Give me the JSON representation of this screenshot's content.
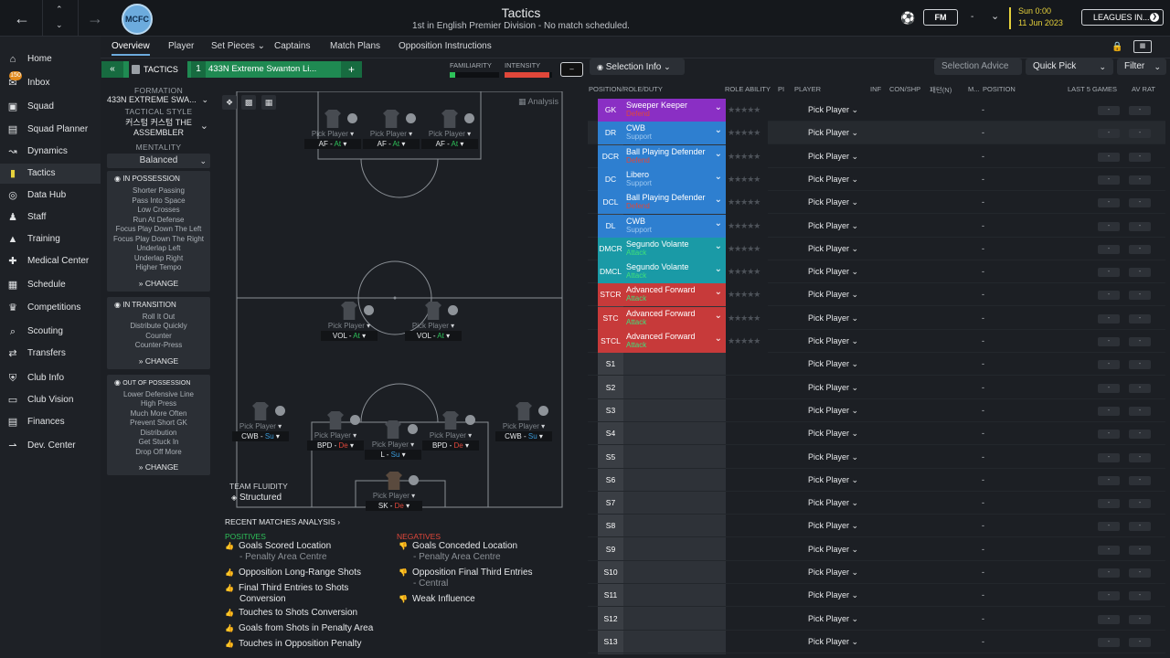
{
  "header": {
    "title": "Tactics",
    "subtitle": "1st in English Premier Division - No match scheduled.",
    "crest_text": "MCFC",
    "date_time": "Sun 0:00",
    "date": "11 Jun 2023",
    "fm_label": "FM",
    "leagues_label": "LEAGUES IN...",
    "dash": "-"
  },
  "sidebar": {
    "items": [
      {
        "label": "Home",
        "icon": "home-icon"
      },
      {
        "label": "Inbox",
        "icon": "inbox-icon",
        "badge": "150"
      },
      {
        "label": "Squad",
        "icon": "shirt-icon"
      },
      {
        "label": "Squad Planner",
        "icon": "planner-icon"
      },
      {
        "label": "Dynamics",
        "icon": "dynamics-icon"
      },
      {
        "label": "Tactics",
        "icon": "tactics-icon"
      },
      {
        "label": "Data Hub",
        "icon": "datahub-icon"
      },
      {
        "label": "Staff",
        "icon": "staff-icon"
      },
      {
        "label": "Training",
        "icon": "training-icon"
      },
      {
        "label": "Medical Center",
        "icon": "medical-icon"
      },
      {
        "label": "Schedule",
        "icon": "calendar-icon"
      },
      {
        "label": "Competitions",
        "icon": "trophy-icon"
      },
      {
        "label": "Scouting",
        "icon": "search-icon"
      },
      {
        "label": "Transfers",
        "icon": "transfer-icon"
      },
      {
        "label": "Club Info",
        "icon": "shield-icon"
      },
      {
        "label": "Club Vision",
        "icon": "vision-icon"
      },
      {
        "label": "Finances",
        "icon": "finances-icon"
      },
      {
        "label": "Dev. Center",
        "icon": "dev-icon"
      }
    ]
  },
  "tabs": [
    "Overview",
    "Player",
    "Set Pieces ⌄",
    "Captains",
    "Match Plans",
    "Opposition Instructions"
  ],
  "tactic_bar": {
    "tactics_label": "TACTICS",
    "slot": "1",
    "tactic_name": "433N Extreme Swanton Li...",
    "add": "+",
    "familiarity_label": "FAMILIARITY",
    "intensity_label": "INTENSITY",
    "selection_info": "Selection Info",
    "selection_advice": "Selection Advice",
    "quick_pick": "Quick Pick",
    "filter": "Filter",
    "familiarity_level": 0.12,
    "intensity_level": 0.95
  },
  "left_panel": {
    "formation_label": "FORMATION",
    "formation_value": "433N EXTREME SWA...",
    "style_label": "TACTICAL STYLE",
    "style_value_1": "커스텀 커스텀 THE",
    "style_value_2": "ASSEMBLER",
    "mentality_label": "MENTALITY",
    "mentality_value": "Balanced",
    "in_possession_title": "IN POSSESSION",
    "in_possession": [
      "Shorter Passing",
      "Pass Into Space",
      "Low Crosses",
      "Run At Defense",
      "Focus Play Down The Left",
      "Focus Play Down The Right",
      "Underlap Left",
      "Underlap Right",
      "Higher Tempo"
    ],
    "in_transition_title": "IN TRANSITION",
    "in_transition": [
      "Roll It Out",
      "Distribute Quickly",
      "Counter",
      "Counter-Press"
    ],
    "out_possession_title": "OUT OF POSSESSION",
    "out_possession": [
      "Lower Defensive Line",
      "High Press",
      "Much More Often",
      "Prevent Short GK",
      "Distribution",
      "Get Stuck In",
      "Drop Off More"
    ],
    "change_label": "CHANGE"
  },
  "pitch": {
    "analysis_label": "Analysis",
    "team_fluidity_label": "TEAM FLUIDITY",
    "team_fluidity_value": "Structured",
    "pick_label": "Pick Player",
    "players": [
      {
        "role": "AF",
        "duty": "At"
      },
      {
        "role": "AF",
        "duty": "At"
      },
      {
        "role": "AF",
        "duty": "At"
      },
      {
        "role": "VOL",
        "duty": "At"
      },
      {
        "role": "VOL",
        "duty": "At"
      },
      {
        "role": "CWB",
        "duty": "Su"
      },
      {
        "role": "BPD",
        "duty": "De"
      },
      {
        "role": "L",
        "duty": "Su"
      },
      {
        "role": "BPD",
        "duty": "De"
      },
      {
        "role": "CWB",
        "duty": "Su"
      },
      {
        "role": "SK",
        "duty": "De"
      }
    ]
  },
  "analysis": {
    "title": "RECENT MATCHES ANALYSIS",
    "positives_label": "POSITIVES",
    "negatives_label": "NEGATIVES",
    "positives": [
      {
        "text": "Goals Scored Location",
        "sub": "- Penalty Area Centre"
      },
      {
        "text": "Opposition Long-Range Shots",
        "sub": ""
      },
      {
        "text": "Final Third Entries to Shots",
        "sub": "Conversion"
      },
      {
        "text": "Touches to Shots Conversion",
        "sub": ""
      },
      {
        "text": "Goals from Shots in Penalty Area",
        "sub": ""
      },
      {
        "text": "Touches in Opposition Penalty",
        "sub": ""
      }
    ],
    "negatives": [
      {
        "text": "Goals Conceded Location",
        "sub": "- Penalty Area Centre"
      },
      {
        "text": "Opposition Final Third Entries",
        "sub": "- Central"
      },
      {
        "text": "Weak Influence",
        "sub": ""
      }
    ]
  },
  "table": {
    "headers": [
      "POSITION/ROLE/DUTY",
      "ROLE ABILITY",
      "PI",
      "PLAYER",
      "INF",
      "CON/SHP",
      "패턴(N)",
      "M...",
      "POSITION",
      "LAST 5 GAMES",
      "AV RAT"
    ],
    "pick_label": "Pick Player",
    "dash": "-",
    "stars": "★★★★★",
    "rows": [
      {
        "pos": "GK",
        "role": "Sweeper Keeper",
        "duty": "Defend",
        "color": "#8a2fc4",
        "duty_color": "#e0473a"
      },
      {
        "pos": "DR",
        "role": "CWB",
        "duty": "Support",
        "color": "#2e7fd0",
        "duty_color": "#9ec9f0"
      },
      {
        "pos": "DCR",
        "role": "Ball Playing Defender",
        "duty": "Defend",
        "color": "#2e7fd0",
        "duty_color": "#e0473a"
      },
      {
        "pos": "DC",
        "role": "Libero",
        "duty": "Support",
        "color": "#2e7fd0",
        "duty_color": "#9ec9f0"
      },
      {
        "pos": "DCL",
        "role": "Ball Playing Defender",
        "duty": "Defend",
        "color": "#2e7fd0",
        "duty_color": "#e0473a"
      },
      {
        "pos": "DL",
        "role": "CWB",
        "duty": "Support",
        "color": "#2e7fd0",
        "duty_color": "#9ec9f0"
      },
      {
        "pos": "DMCR",
        "role": "Segundo Volante",
        "duty": "Attack",
        "color": "#1a9aa6",
        "duty_color": "#3fe07a"
      },
      {
        "pos": "DMCL",
        "role": "Segundo Volante",
        "duty": "Attack",
        "color": "#1a9aa6",
        "duty_color": "#3fe07a"
      },
      {
        "pos": "STCR",
        "role": "Advanced Forward",
        "duty": "Attack",
        "color": "#c73a3a",
        "duty_color": "#3fe07a"
      },
      {
        "pos": "STC",
        "role": "Advanced Forward",
        "duty": "Attack",
        "color": "#c73a3a",
        "duty_color": "#3fe07a"
      },
      {
        "pos": "STCL",
        "role": "Advanced Forward",
        "duty": "Attack",
        "color": "#c73a3a",
        "duty_color": "#3fe07a"
      },
      {
        "pos": "S1"
      },
      {
        "pos": "S2"
      },
      {
        "pos": "S3"
      },
      {
        "pos": "S4"
      },
      {
        "pos": "S5"
      },
      {
        "pos": "S6"
      },
      {
        "pos": "S7"
      },
      {
        "pos": "S8"
      },
      {
        "pos": "S9"
      },
      {
        "pos": "S10"
      },
      {
        "pos": "S11"
      },
      {
        "pos": "S12"
      },
      {
        "pos": "S13"
      }
    ]
  }
}
